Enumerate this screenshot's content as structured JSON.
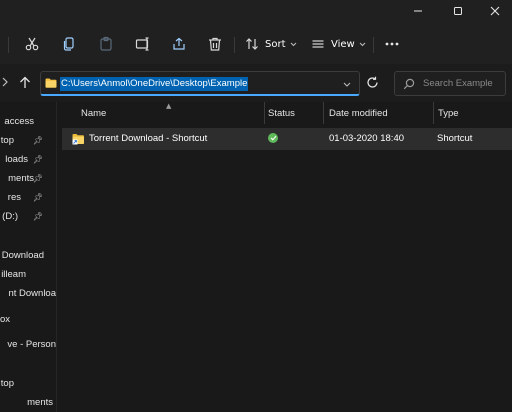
{
  "toolbar": {
    "sort_label": "Sort",
    "view_label": "View"
  },
  "address": {
    "path": "C:\\Users\\Anmol\\OneDrive\\Desktop\\Example"
  },
  "search": {
    "placeholder": "Search Example"
  },
  "sidebar": {
    "items": [
      {
        "label": "access",
        "pinned": false
      },
      {
        "label": "top",
        "pinned": true
      },
      {
        "label": "loads",
        "pinned": true
      },
      {
        "label": "ments",
        "pinned": true
      },
      {
        "label": "res",
        "pinned": true
      },
      {
        "label": "(D:)",
        "pinned": true
      },
      {
        "label": "Download",
        "pinned": false
      },
      {
        "label": "illeam",
        "pinned": false
      },
      {
        "label": "nt Downloa",
        "pinned": false
      },
      {
        "label": "ox",
        "pinned": false
      },
      {
        "label": "ve - Person",
        "pinned": false
      },
      {
        "label": "top",
        "pinned": false
      },
      {
        "label": "ments",
        "pinned": false
      }
    ]
  },
  "columns": {
    "name": "Name",
    "status": "Status",
    "date": "Date modified",
    "type": "Type"
  },
  "files": [
    {
      "name": "Torrent Download - Shortcut",
      "date": "01-03-2020 18:40",
      "type": "Shortcut"
    }
  ],
  "colors": {
    "accent": "#0063b1",
    "focus_border": "#4aa8ff",
    "status_ok": "#5fb85a"
  }
}
